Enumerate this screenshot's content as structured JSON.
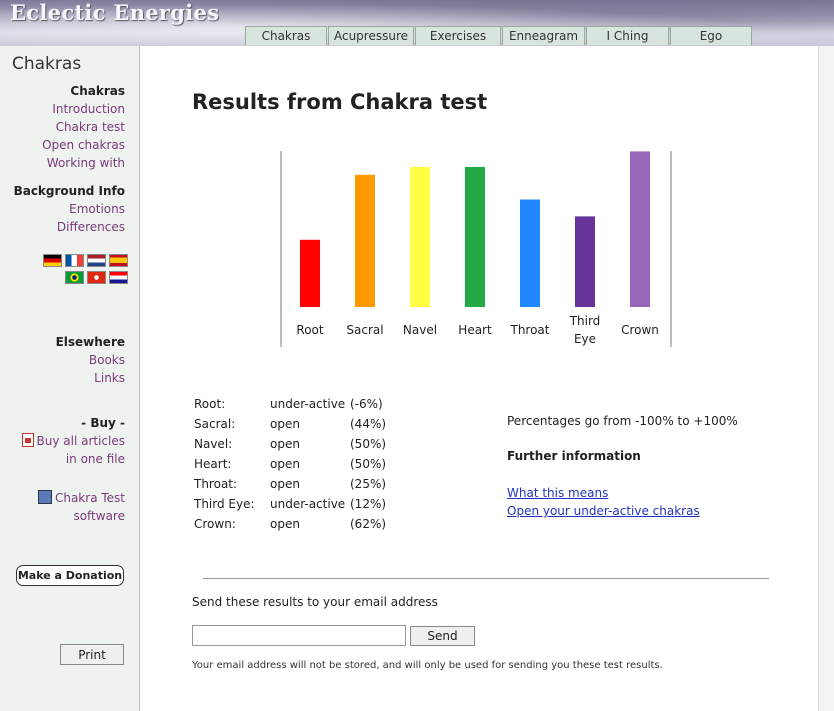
{
  "header": {
    "site_title": "Eclectic Energies",
    "tabs": [
      {
        "label": "Chakras"
      },
      {
        "label": "Acupressure"
      },
      {
        "label": "Exercises"
      },
      {
        "label": "Enneagram"
      },
      {
        "label": "I Ching"
      },
      {
        "label": "Ego"
      }
    ]
  },
  "sidebar": {
    "title": "Chakras",
    "section_chakras": {
      "heading": "Chakras",
      "links": [
        "Introduction",
        "Chakra test",
        "Open chakras",
        "Working with"
      ]
    },
    "section_background": {
      "heading": "Background Info",
      "links": [
        "Emotions",
        "Differences"
      ]
    },
    "flags": [
      {
        "name": "german-flag",
        "colors": [
          "#000000",
          "#dd0000",
          "#ffce00"
        ]
      },
      {
        "name": "french-flag",
        "colors": [
          "#0055a4",
          "#ffffff",
          "#ef4135"
        ]
      },
      {
        "name": "dutch-flag",
        "colors": [
          "#ae1c28",
          "#ffffff",
          "#21468b"
        ]
      },
      {
        "name": "spanish-flag",
        "colors": [
          "#c60b1e",
          "#ffc400",
          "#c60b1e"
        ]
      },
      {
        "name": "brazilian-flag",
        "colors": [
          "#009c3b",
          "#ffdf00",
          "#002776"
        ]
      },
      {
        "name": "hong-kong-flag",
        "colors": [
          "#de2910",
          "#ffffff",
          "#de2910"
        ]
      },
      {
        "name": "croatian-flag",
        "colors": [
          "#ff0000",
          "#ffffff",
          "#171796"
        ]
      }
    ],
    "section_elsewhere": {
      "heading": "Elsewhere",
      "links": [
        "Books",
        "Links"
      ]
    },
    "section_buy": {
      "heading": "- Buy -",
      "buy_line1": "Buy all articles",
      "buy_line2": "in one file",
      "software_line1": "Chakra Test",
      "software_line2": "software"
    },
    "donate_label": "Make a Donation",
    "print_label": "Print"
  },
  "main": {
    "page_title": "Results from Chakra test",
    "results": [
      {
        "name": "Root:",
        "status": "under-active",
        "pct": "(-6%)"
      },
      {
        "name": "Sacral:",
        "status": "open",
        "pct": "(44%)"
      },
      {
        "name": "Navel:",
        "status": "open",
        "pct": "(50%)"
      },
      {
        "name": "Heart:",
        "status": "open",
        "pct": "(50%)"
      },
      {
        "name": "Throat:",
        "status": "open",
        "pct": "(25%)"
      },
      {
        "name": "Third Eye:",
        "status": "under-active",
        "pct": "(12%)"
      },
      {
        "name": "Crown:",
        "status": "open",
        "pct": "(62%)"
      }
    ],
    "info": {
      "percent_note": "Percentages go from -100% to +100%",
      "further_heading": "Further information",
      "link_meaning": "What this means",
      "link_open": "Open your under-active chakras"
    },
    "email": {
      "label": "Send these results to your email address",
      "value": "",
      "placeholder": "",
      "send_label": "Send",
      "privacy": "Your email address will not be stored, and will only be used for sending you these test results."
    }
  },
  "chart_data": {
    "type": "bar",
    "categories": [
      "Root",
      "Sacral",
      "Navel",
      "Heart",
      "Throat",
      "Third Eye",
      "Crown"
    ],
    "values": [
      -6,
      44,
      50,
      50,
      25,
      12,
      62
    ],
    "colors": [
      "#ff0000",
      "#ff9900",
      "#ffff44",
      "#22aa44",
      "#2288ff",
      "#663399",
      "#9966bb"
    ],
    "ylim": [
      -100,
      100
    ]
  }
}
